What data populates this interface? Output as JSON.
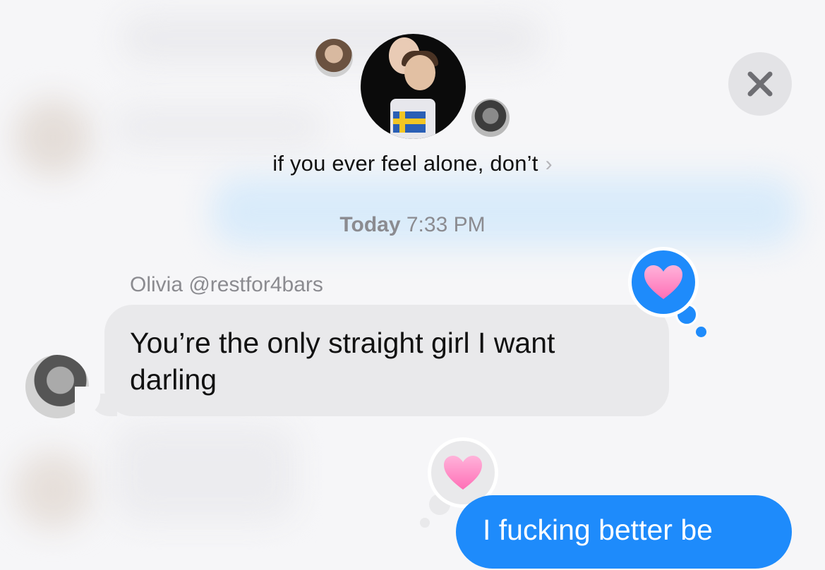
{
  "header": {
    "group_title": "if you ever feel alone, don’t",
    "chevron": "›",
    "close_icon": "close-icon"
  },
  "timestamp": {
    "day": "Today",
    "time": "7:33 PM"
  },
  "messages": [
    {
      "direction": "incoming",
      "sender": "Olivia @restfor4bars",
      "text": "You’re the only straight girl I want darling",
      "tapback": "heart"
    },
    {
      "direction": "outgoing",
      "text": "I fucking better be",
      "tapback": "heart"
    }
  ],
  "colors": {
    "outgoing_bubble": "#1e8bfb",
    "incoming_bubble": "#e9e9eb",
    "secondary_text": "#8b8b90",
    "heart": "#ff8fc8"
  }
}
